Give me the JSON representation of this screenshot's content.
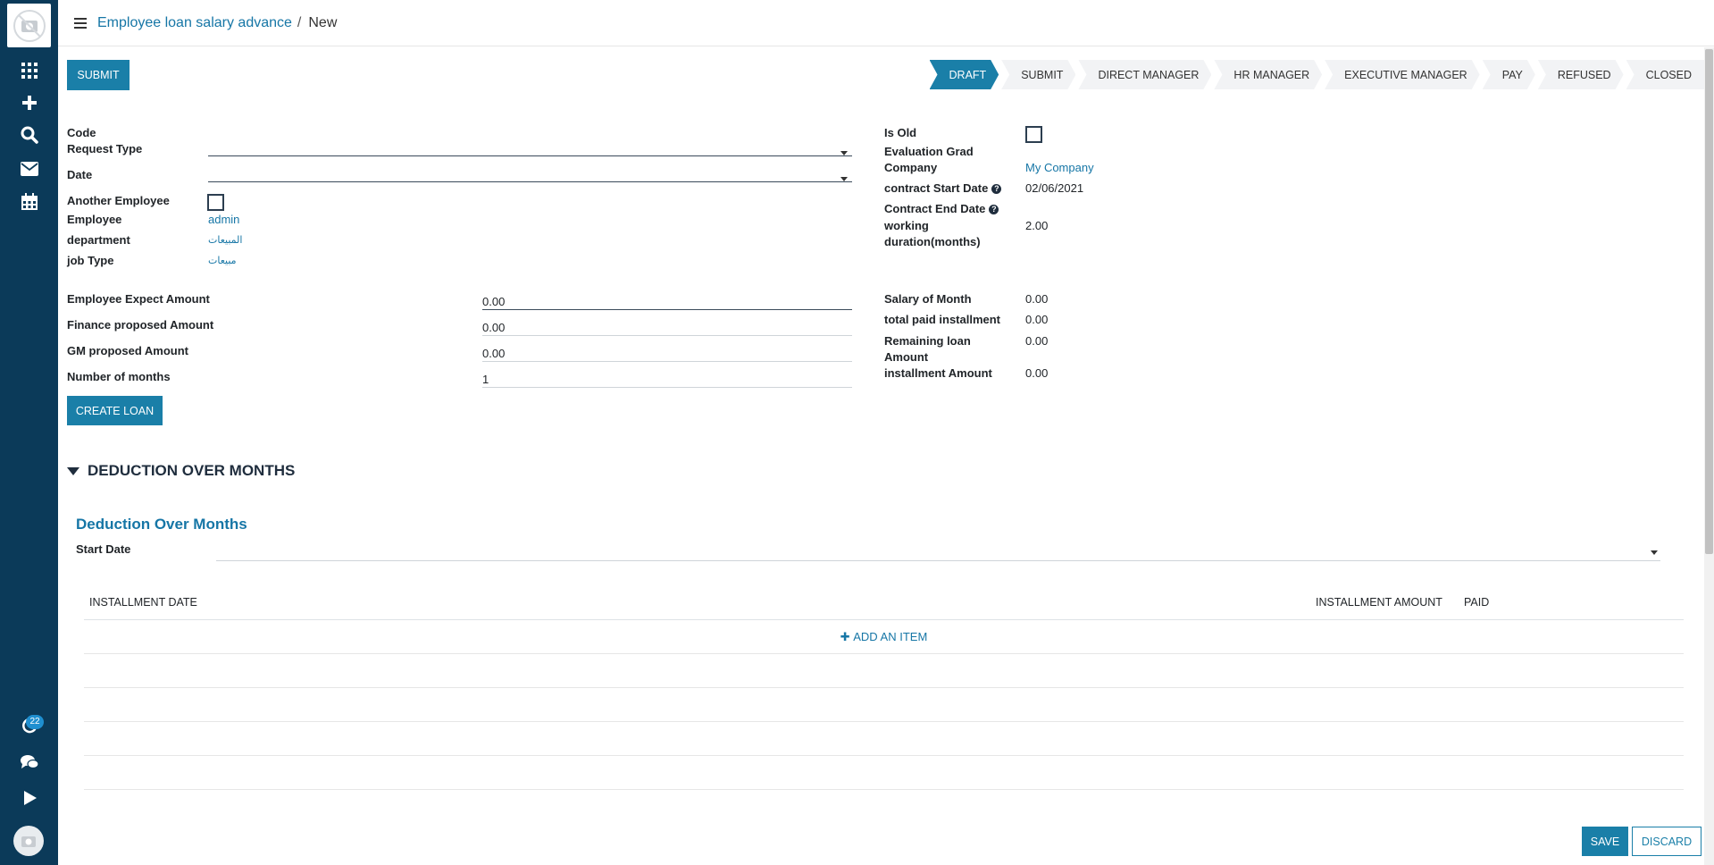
{
  "breadcrumb": {
    "parent": "Employee loan salary advance",
    "separator": "/",
    "current": "New"
  },
  "sidebar": {
    "notifications_badge": "22"
  },
  "header": {
    "submit_label": "SUBMIT",
    "stages": [
      {
        "label": "DRAFT",
        "active": true
      },
      {
        "label": "SUBMIT"
      },
      {
        "label": "DIRECT MANAGER"
      },
      {
        "label": "HR MANAGER"
      },
      {
        "label": "EXECUTIVE MANAGER"
      },
      {
        "label": "PAY"
      },
      {
        "label": "REFUSED"
      },
      {
        "label": "CLOSED"
      }
    ]
  },
  "left": {
    "code_label": "Code",
    "request_type_label": "Request Type",
    "date_label": "Date",
    "another_employee_label": "Another Employee",
    "employee_label": "Employee",
    "employee_value": "admin",
    "department_label": "department",
    "department_value": "المبيعات",
    "job_type_label": "job Type",
    "job_type_value": "مبيعات"
  },
  "right": {
    "is_old_label": "Is Old",
    "evaluation_grad_label": "Evaluation Grad",
    "company_label": "Company",
    "company_value": "My Company",
    "contract_start_label": "contract Start Date",
    "contract_start_value": "02/06/2021",
    "contract_end_label": "Contract End Date",
    "working_duration_label_1": "working",
    "working_duration_label_2": "duration(months)",
    "working_duration_value": "2.00",
    "help_glyph": "?"
  },
  "amounts": {
    "employee_expect_label": "Employee Expect Amount",
    "employee_expect_value": "0.00",
    "finance_proposed_label": "Finance proposed Amount",
    "finance_proposed_value": "0.00",
    "gm_proposed_label": "GM proposed Amount",
    "gm_proposed_value": "0.00",
    "months_label": "Number of months",
    "months_value": "1",
    "create_loan_label": "CREATE LOAN"
  },
  "summary": {
    "salary_month_label": "Salary of Month",
    "salary_month_value": "0.00",
    "total_paid_label": "total paid installment",
    "total_paid_value": "0.00",
    "remaining_label_1": "Remaining loan",
    "remaining_label_2": "Amount",
    "remaining_value": "0.00",
    "installment_label": "installment Amount",
    "installment_value": "0.00"
  },
  "deduction": {
    "section_title": "DEDUCTION OVER MONTHS",
    "sub_title": "Deduction Over Months",
    "start_date_label": "Start Date",
    "columns": [
      "INSTALLMENT DATE",
      "INSTALLMENT AMOUNT",
      "PAID"
    ],
    "add_item_label": "ADD AN ITEM"
  },
  "footer": {
    "save_label": "SAVE",
    "discard_label": "DISCARD"
  }
}
